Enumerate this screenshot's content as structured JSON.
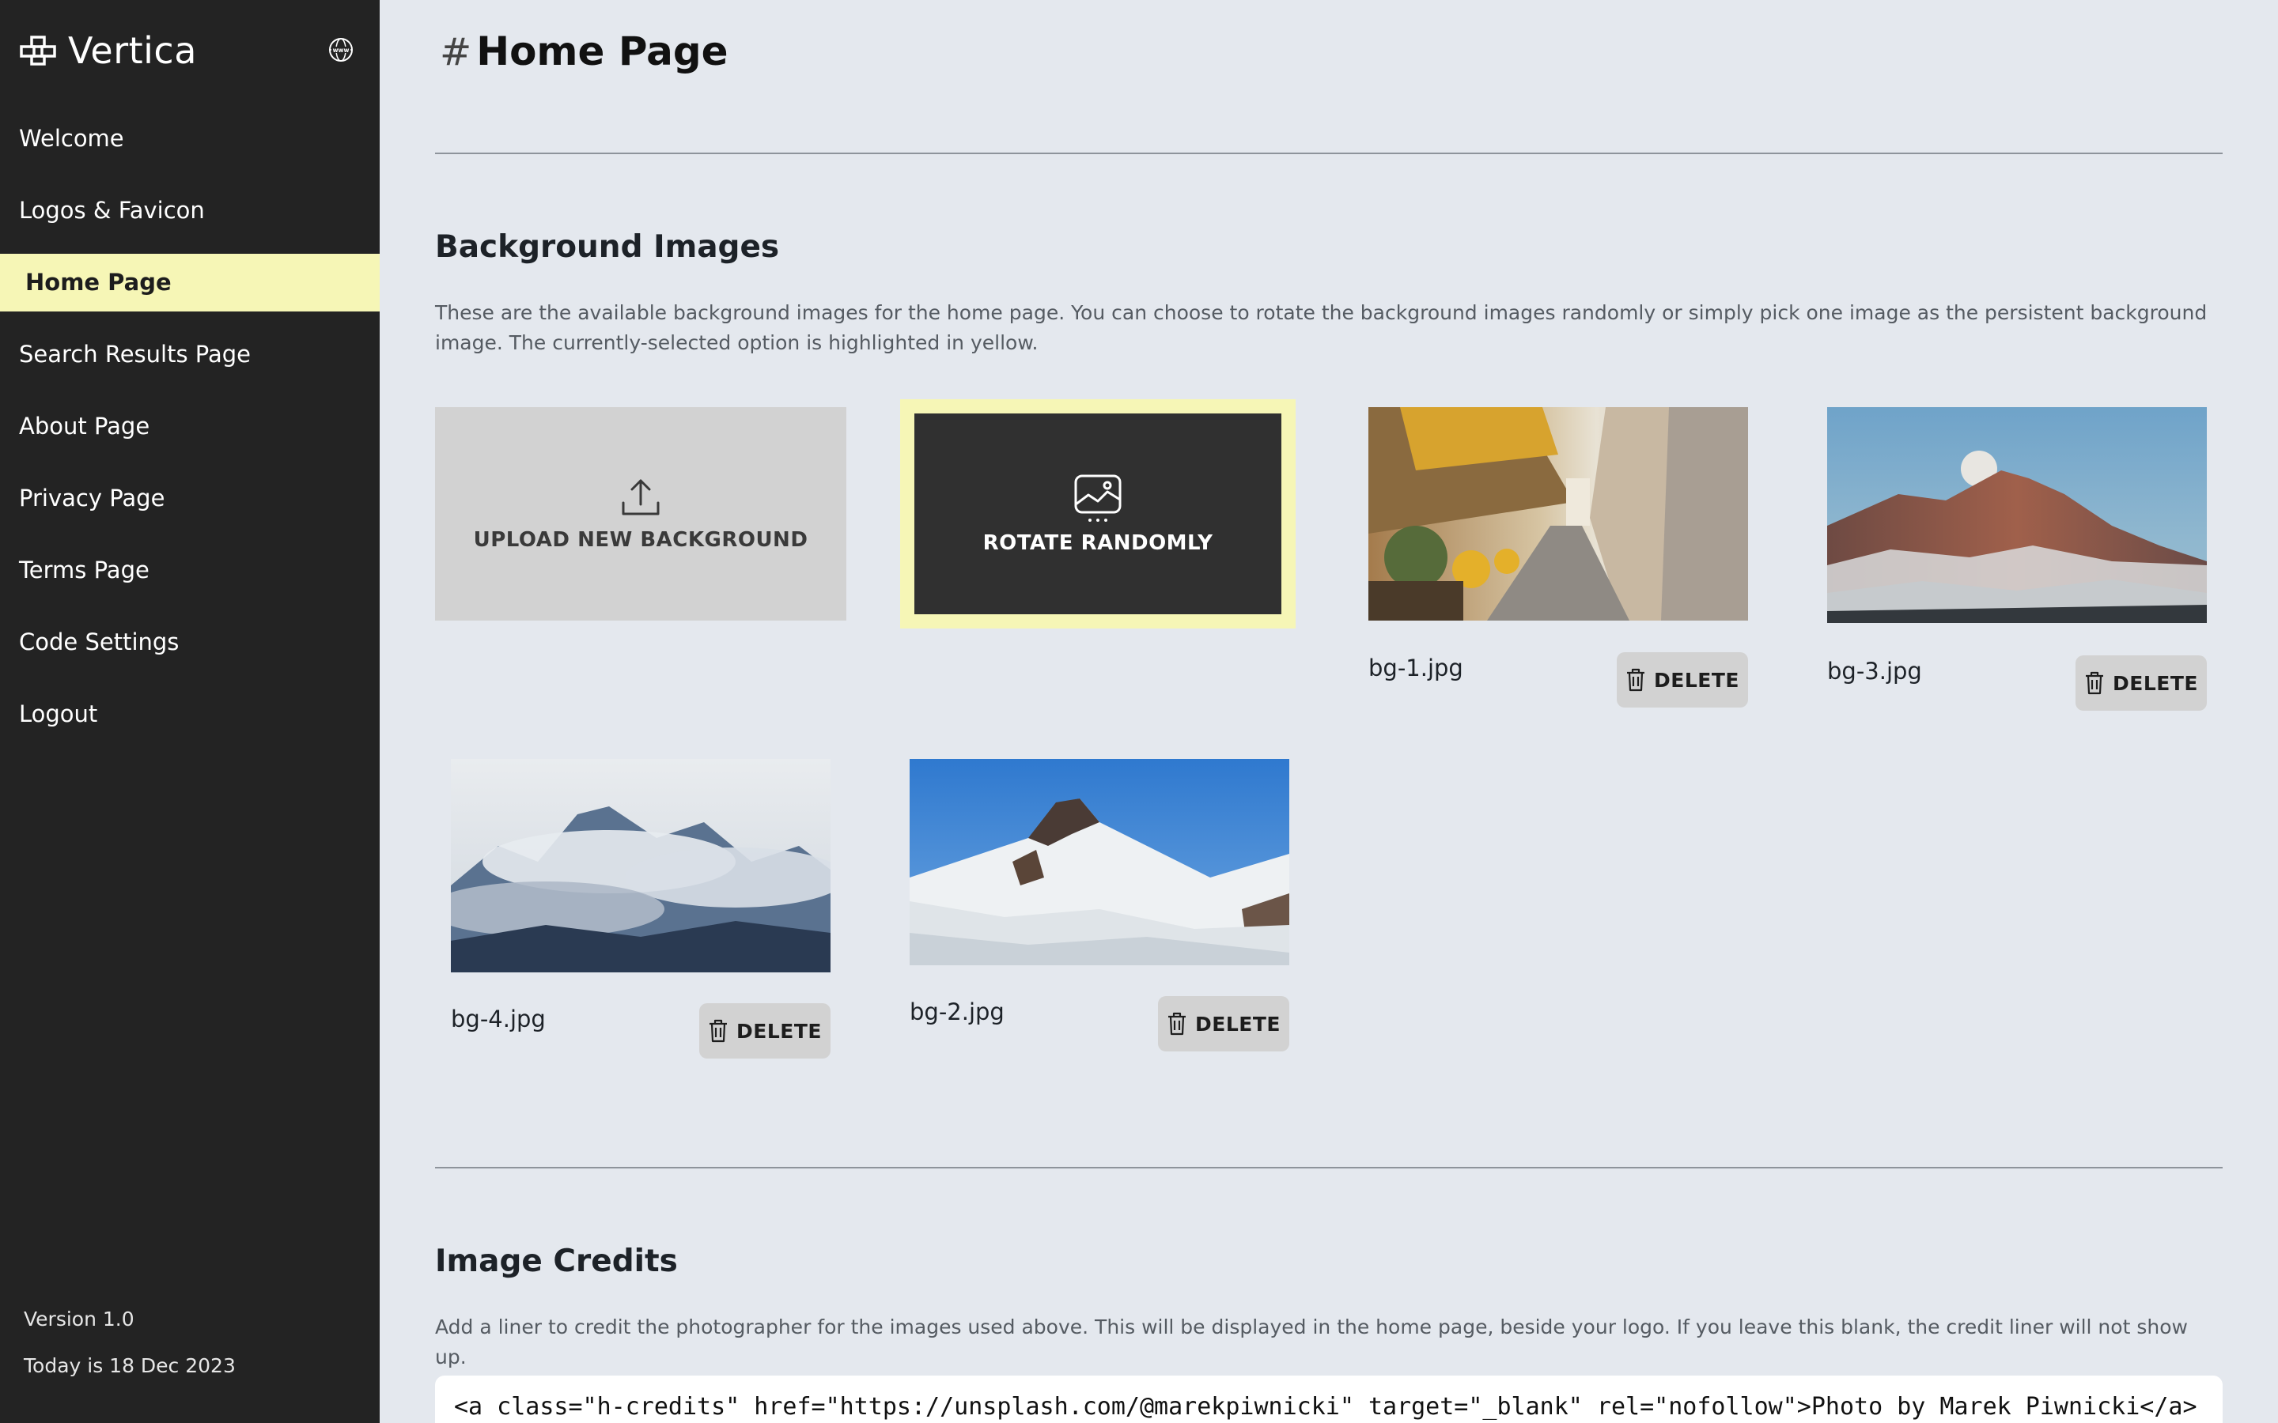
{
  "sidebar": {
    "brand": "Vertica",
    "nav": [
      {
        "label": "Welcome"
      },
      {
        "label": "Logos & Favicon"
      },
      {
        "label": "Home Page",
        "active": true
      },
      {
        "label": "Search Results Page"
      },
      {
        "label": "About Page"
      },
      {
        "label": "Privacy Page"
      },
      {
        "label": "Terms Page"
      },
      {
        "label": "Code Settings"
      },
      {
        "label": "Logout"
      }
    ],
    "version": "Version 1.0",
    "today": "Today is 18 Dec 2023"
  },
  "main": {
    "title_hash": "#",
    "title": "Home Page",
    "bg_section": {
      "title": "Background Images",
      "description": "These are the available background images for the home page. You can choose to rotate the background images randomly or simply pick one image as the persistent background image. The currently-selected option is highlighted in yellow.",
      "upload_label": "UPLOAD NEW BACKGROUND",
      "rotate_label": "ROTATE RANDOMLY",
      "delete_label": "DELETE",
      "images": [
        {
          "filename": "bg-1.jpg"
        },
        {
          "filename": "bg-3.jpg"
        },
        {
          "filename": "bg-4.jpg"
        },
        {
          "filename": "bg-2.jpg"
        }
      ]
    },
    "credits_section": {
      "title": "Image Credits",
      "description": "Add a liner to credit the photographer for the images used above. This will be displayed in the home page, beside your logo. If you leave this blank, the credit liner will not show up.",
      "value": "<a class=\"h-credits\" href=\"https://unsplash.com/@marekpiwnicki\" target=\"_blank\" rel=\"nofollow\">Photo by Marek Piwnicki</a>"
    }
  },
  "colors": {
    "sidebar_bg": "#232323",
    "active_highlight": "#f6f6b6",
    "page_bg": "#e4e8ee"
  }
}
